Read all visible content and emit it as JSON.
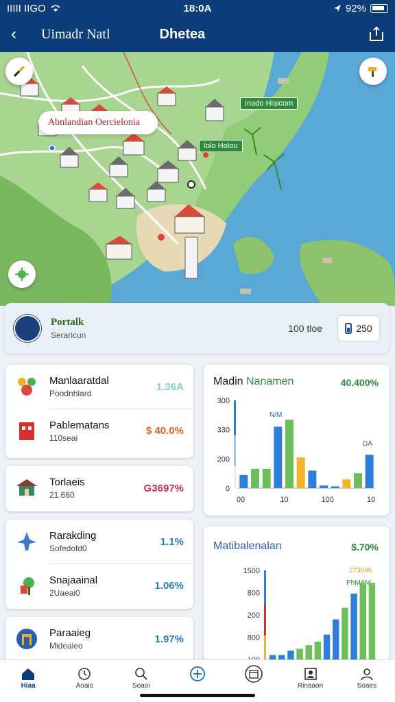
{
  "status_bar": {
    "carrier": "IIIII IIGO",
    "time": "18:0A",
    "battery": "92%"
  },
  "header": {
    "back_label": "‹",
    "title_left": "Uimadr Natl",
    "title_center": "Dhetea"
  },
  "map": {
    "search_text": "Abnlandian Oercielonia",
    "labels": [
      "Inado Hiaicom",
      "Iolo Holou"
    ]
  },
  "summary": {
    "title": "Portalk",
    "subtitle": "Seraricun",
    "value": "100 tloe",
    "badge_value": "250"
  },
  "list_card_1": [
    {
      "name": "Manlaaratdal",
      "sub": "Poodnhlard",
      "pct": "1.36A",
      "color": "#7fd3c4"
    },
    {
      "name": "Pablematans",
      "sub": "110seai",
      "pct": "$ 40.0%",
      "color": "#e06020"
    }
  ],
  "list_card_2": [
    {
      "name": "Torlaeis",
      "sub": "21.660",
      "pct": "G3697%",
      "color": "#d0304a"
    }
  ],
  "list_card_3": [
    {
      "name": "Rarakding",
      "sub": "Sofedofd0",
      "pct": "1.1%",
      "color": "#2a7ac0"
    },
    {
      "name": "Snajaainal",
      "sub": "2Uaeai0",
      "pct": "1.06%",
      "color": "#2a7ac0"
    }
  ],
  "list_card_4": [
    {
      "name": "Paraaieg",
      "sub": "Mideaieo",
      "pct": "1.97%",
      "color": "#2a7ac0"
    }
  ],
  "chart1": {
    "title_part1": "Madin ",
    "title_part2": "Nanamen",
    "value": "40.400%",
    "annotation_1": "N/M",
    "annotation_2": "DA"
  },
  "chart2": {
    "title": "Matibalenalan",
    "value": "$.70%",
    "annotation_1": "273096",
    "annotation_2": "PhMAM"
  },
  "chart_data": [
    {
      "type": "bar",
      "yticks": [
        "300",
        "330",
        "200",
        "0"
      ],
      "xticks": [
        "00",
        "10",
        "100",
        "10"
      ],
      "values": [
        0.15,
        0.22,
        0.22,
        0.7,
        0.78,
        0.35,
        0.2,
        0.03,
        0.02,
        0.1,
        0.17,
        0.38
      ],
      "colors": [
        "#2f7fd8",
        "#6cbf5a",
        "#6cbf5a",
        "#2f7fd8",
        "#6cbf5a",
        "#f2b52a",
        "#2f7fd8",
        "#2f7fd8",
        "#2f7fd8",
        "#f2b52a",
        "#6cbf5a",
        "#2f7fd8"
      ],
      "ylim": [
        0,
        1
      ]
    },
    {
      "type": "bar",
      "yticks": [
        "1500",
        "800",
        "200",
        "800",
        "100"
      ],
      "values": [
        0.05,
        0.05,
        0.1,
        0.12,
        0.16,
        0.2,
        0.28,
        0.45,
        0.58,
        0.74,
        0.86,
        0.86
      ],
      "colors": [
        "#2f7fd8",
        "#2f7fd8",
        "#2f7fd8",
        "#6cbf5a",
        "#6cbf5a",
        "#6cbf5a",
        "#2f7fd8",
        "#2f7fd8",
        "#6cbf5a",
        "#2f7fd8",
        "#6cbf5a",
        "#6cbf5a"
      ],
      "ylim": [
        0,
        1
      ]
    }
  ],
  "bottom_nav": [
    {
      "label": "Hiaa",
      "icon": "home-icon",
      "active": true
    },
    {
      "label": "Aoaio",
      "icon": "clock-icon",
      "active": false
    },
    {
      "label": "Soaoi",
      "icon": "search-icon",
      "active": false
    },
    {
      "label": "",
      "icon": "plus-icon",
      "active": false
    },
    {
      "label": "",
      "icon": "calendar-icon",
      "active": false
    },
    {
      "label": "Rinaaon",
      "icon": "profile-card-icon",
      "active": false
    },
    {
      "label": "Soaes",
      "icon": "user-icon",
      "active": false
    }
  ]
}
